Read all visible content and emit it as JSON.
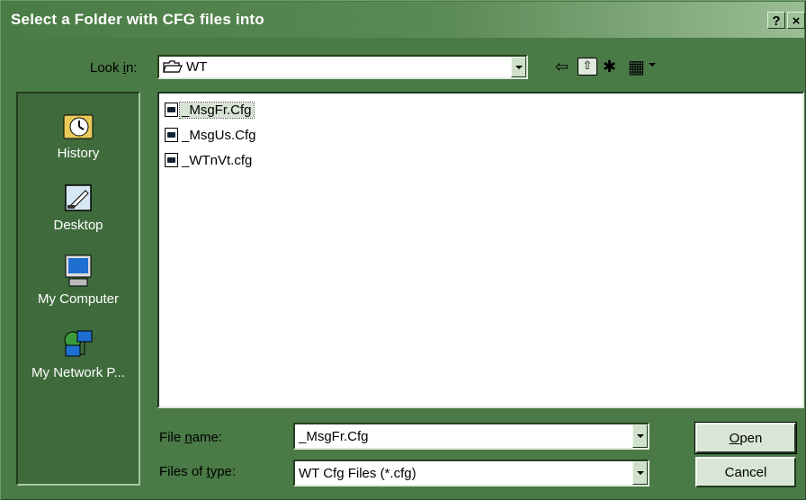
{
  "window": {
    "title": "Select a Folder with CFG files into",
    "help_glyph": "?",
    "close_glyph": "×"
  },
  "lookin": {
    "label_pre": "Look ",
    "label_accel": "i",
    "label_post": "n:",
    "value": "WT"
  },
  "toolbar": {
    "back_glyph": "⇦",
    "up_glyph": "⇧",
    "newfolder_glyph": "✱",
    "view_glyph": "▦"
  },
  "places": [
    {
      "label": "History",
      "icon": "history-icon"
    },
    {
      "label": "Desktop",
      "icon": "desktop-icon"
    },
    {
      "label": "My Computer",
      "icon": "my-computer-icon"
    },
    {
      "label": "My Network P...",
      "icon": "network-places-icon"
    }
  ],
  "files": [
    {
      "name": "_MsgFr.Cfg",
      "selected": true
    },
    {
      "name": "_MsgUs.Cfg",
      "selected": false
    },
    {
      "name": "_WTnVt.cfg",
      "selected": false
    }
  ],
  "filename": {
    "label_pre": "File ",
    "label_accel": "n",
    "label_post": "ame:",
    "value": "_MsgFr.Cfg"
  },
  "filetype": {
    "label_pre": "Files of ",
    "label_accel": "t",
    "label_post": "ype:",
    "value": "WT Cfg Files (*.cfg)"
  },
  "buttons": {
    "open_accel": "O",
    "open_rest": "pen",
    "cancel": "Cancel"
  },
  "colors": {
    "window_bg": "#4a7a46",
    "title_gradient_end": "#9bbd95"
  }
}
